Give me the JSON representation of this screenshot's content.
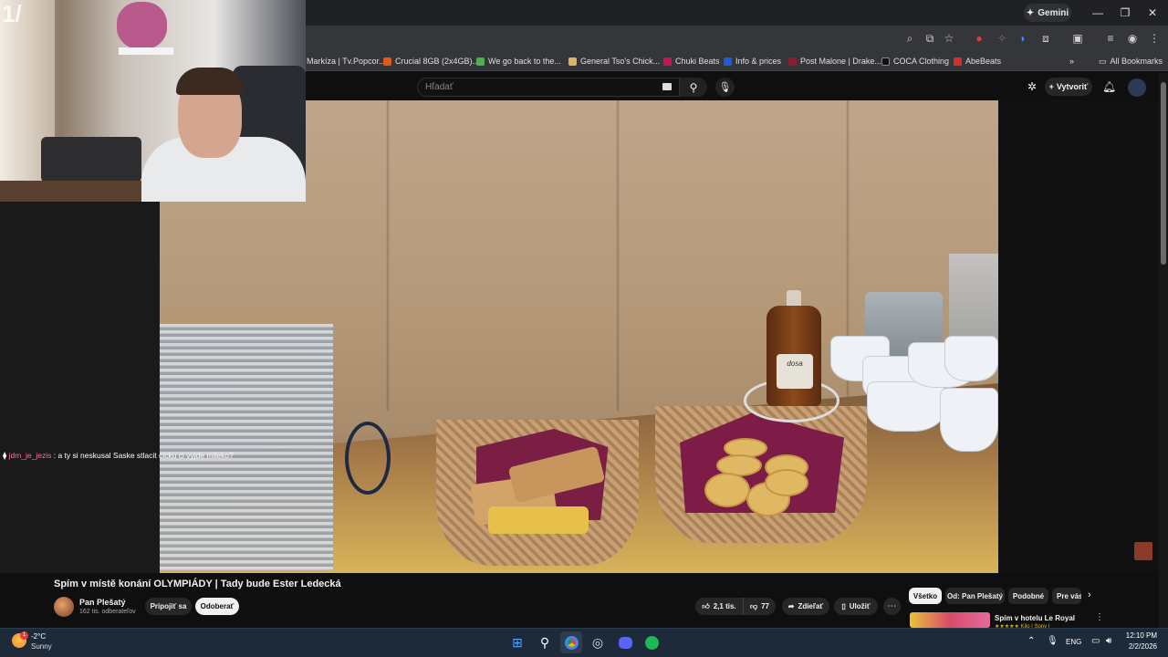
{
  "browser": {
    "gemini_label": "Gemini",
    "bookmarks": [
      {
        "label": "Markíza | Tv.Popcor...",
        "color": "#3a7bd5"
      },
      {
        "label": "Crucial 8GB (2x4GB)...",
        "color": "#e05a1e"
      },
      {
        "label": "We go back to the...",
        "color": "#4caf50"
      },
      {
        "label": "General Tso's Chick...",
        "color": "#d8b56a"
      },
      {
        "label": "Chuki Beats",
        "color": "#c2185b"
      },
      {
        "label": "Info & prices",
        "color": "#1e5bd6"
      },
      {
        "label": "Post Malone | Drake...",
        "color": "#8b1e2e"
      },
      {
        "label": "COCA Clothing",
        "color": "#111111"
      },
      {
        "label": "AbeBeats",
        "color": "#d32f2f"
      }
    ],
    "all_bookmarks": "All Bookmarks"
  },
  "youtube": {
    "search_placeholder": "Hľadať",
    "create_label": "Vytvoriť"
  },
  "webcam_overlay": "1/",
  "chat": {
    "username": "jdm_je_jezis",
    "message": ": a ty si neskusal Saske stlacit cicku ci vyjde mlieko?"
  },
  "video_scene": {
    "syrup_label": "dosa"
  },
  "video": {
    "title": "Spím v místě konání OLYMPIÁDY | Tady bude Ester Ledecká",
    "channel": "Pan Plešatý",
    "subscribers": "162 tis. odberateľov",
    "join_label": "Pripojiť sa",
    "unsubscribe_label": "Odoberať",
    "likes": "2,1 tis.",
    "dislikes": "77",
    "share_label": "Zdieľať",
    "save_label": "Uložiť"
  },
  "recommendations": {
    "chips": [
      "Všetko",
      "Od: Pan Plešatý",
      "Podobné",
      "Pre vás"
    ],
    "first_title": "Spím v hotelu Le Royal",
    "first_sub": "★★★★★ Kilo | Sony |"
  },
  "taskbar": {
    "temperature": "-2°C",
    "condition": "Sunny",
    "weather_badge": "1",
    "language": "ENG",
    "time": "12:10 PM",
    "date": "2/2/2026"
  }
}
